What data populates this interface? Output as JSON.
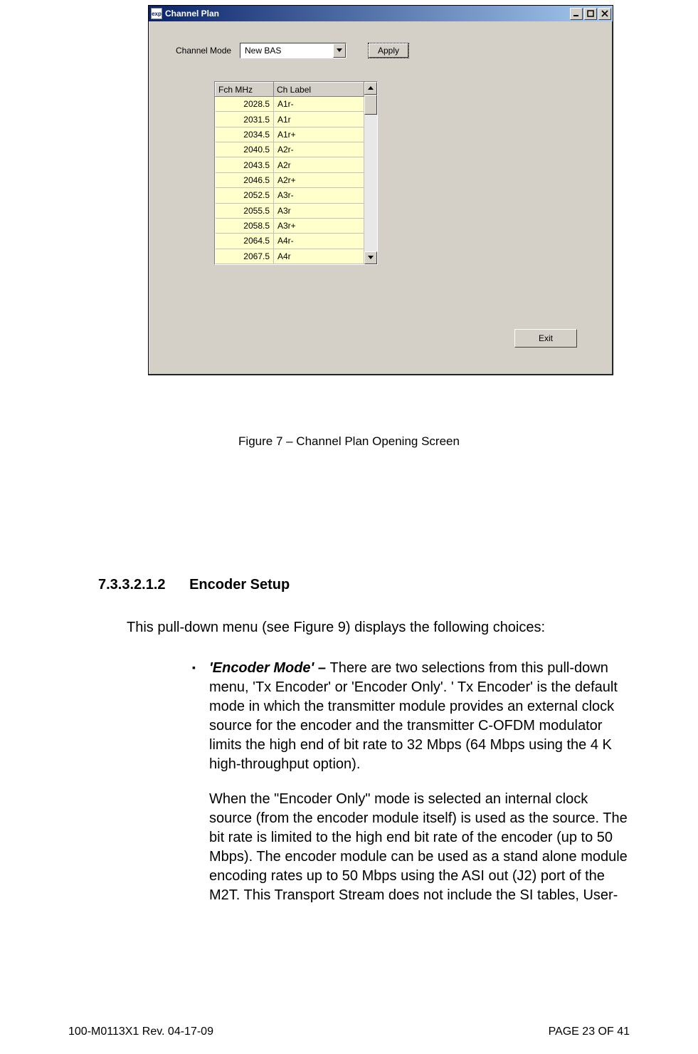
{
  "dialog": {
    "title": "Channel Plan",
    "app_icon_text": "exp",
    "channel_mode_label": "Channel Mode",
    "channel_mode_value": "New BAS",
    "apply_label": "Apply",
    "exit_label": "Exit",
    "grid": {
      "headers": {
        "fch": "Fch MHz",
        "label": "Ch Label"
      },
      "rows": [
        {
          "fch": "2028.5",
          "label": "A1r-"
        },
        {
          "fch": "2031.5",
          "label": "A1r"
        },
        {
          "fch": "2034.5",
          "label": "A1r+"
        },
        {
          "fch": "2040.5",
          "label": "A2r-"
        },
        {
          "fch": "2043.5",
          "label": "A2r"
        },
        {
          "fch": "2046.5",
          "label": "A2r+"
        },
        {
          "fch": "2052.5",
          "label": "A3r-"
        },
        {
          "fch": "2055.5",
          "label": "A3r"
        },
        {
          "fch": "2058.5",
          "label": "A3r+"
        },
        {
          "fch": "2064.5",
          "label": "A4r-"
        },
        {
          "fch": "2067.5",
          "label": "A4r"
        }
      ]
    }
  },
  "caption": "Figure 7 – Channel Plan Opening Screen",
  "section": {
    "number": "7.3.3.2.1.2",
    "title": "Encoder Setup",
    "intro": "This pull-down menu (see Figure 9) displays the following choices:",
    "bullet_lead": "'Encoder Mode' – ",
    "para1": "There are two selections from this pull-down menu, 'Tx Encoder' or 'Encoder Only'. ' Tx Encoder' is the default mode in which the transmitter module provides an external clock source for the encoder and the transmitter C-OFDM modulator limits the high end of bit rate to 32 Mbps (64 Mbps using the 4 K high-throughput option).",
    "para2": "When the \"Encoder Only\" mode is selected an internal clock source (from the encoder module itself) is used as the source.  The bit rate is limited to the high end bit rate of the encoder (up to 50 Mbps). The encoder module can be used as a stand alone module encoding rates up to 50 Mbps using the ASI out (J2) port of the M2T. This Transport Stream does not include the SI tables, User-"
  },
  "footer": {
    "left": "100-M0113X1 Rev. 04-17-09",
    "right": "PAGE 23 OF 41"
  }
}
